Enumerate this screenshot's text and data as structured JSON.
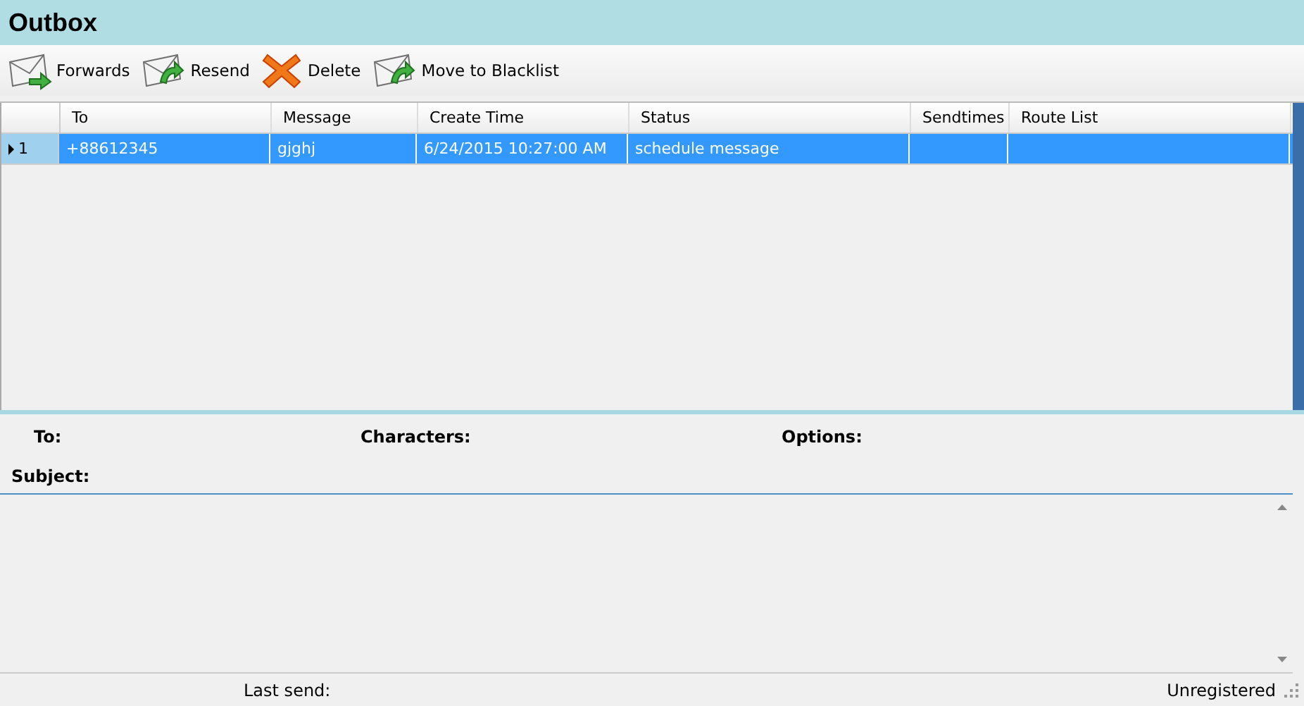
{
  "window": {
    "title": "Outbox"
  },
  "toolbar": [
    {
      "label": "Forwards",
      "kind": "forward"
    },
    {
      "label": "Resend",
      "kind": "resend"
    },
    {
      "label": "Delete",
      "kind": "delete"
    },
    {
      "label": "Move to Blacklist",
      "kind": "blacklist"
    }
  ],
  "table": {
    "columns": [
      "To",
      "Message",
      "Create Time",
      "Status",
      "Sendtimes",
      "Route List"
    ],
    "rows": [
      {
        "number": "1",
        "selected": true,
        "cells": [
          "+88612345",
          "gjghj",
          "6/24/2015 10:27:00 AM",
          "schedule message",
          "",
          ""
        ]
      }
    ]
  },
  "details": {
    "to_label": "To:",
    "characters_label": "Characters:",
    "options_label": "Options:",
    "subject_label": "Subject:"
  },
  "status_bar": {
    "last_send_label": "Last send:",
    "registration": "Unregistered"
  }
}
